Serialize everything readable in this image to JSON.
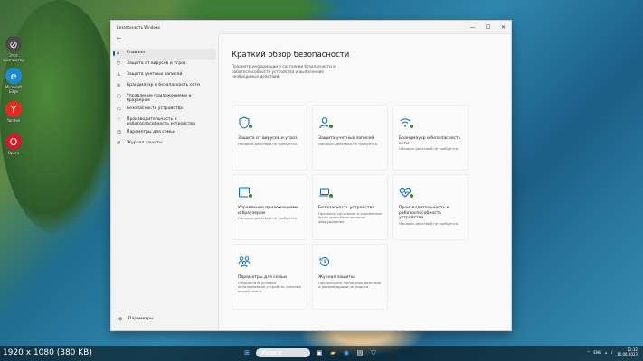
{
  "window": {
    "title": "Безопасность Windows",
    "minimize": "—",
    "maximize": "☐",
    "close": "✕",
    "back": "←"
  },
  "desktop": {
    "icons": [
      {
        "label": "Этот компьютер",
        "icon": "pc-icon",
        "color": "#4a4a4a",
        "glyph": "⊘"
      },
      {
        "label": "Microsoft Edge",
        "icon": "edge-icon",
        "color": "#1f8ad4",
        "glyph": "e"
      },
      {
        "label": "Yandex",
        "icon": "yandex-icon",
        "color": "#e8291c",
        "glyph": "Y"
      },
      {
        "label": "Opera",
        "icon": "opera-icon",
        "color": "#d21a2a",
        "glyph": "O"
      }
    ]
  },
  "sidebar": {
    "items": [
      {
        "icon": "⌂",
        "label": "Главная"
      },
      {
        "icon": "⛉",
        "label": "Защита от вирусов и угроз"
      },
      {
        "icon": "♙",
        "label": "Защита учетных записей"
      },
      {
        "icon": "⊚",
        "label": "Брандмауэр и безопасность сети"
      },
      {
        "icon": "▢",
        "label": "Управление приложениями и браузером"
      },
      {
        "icon": "▭",
        "label": "Безопасность устройства"
      },
      {
        "icon": "♡",
        "label": "Производительность и работоспособность устройства"
      },
      {
        "icon": "☺",
        "label": "Параметры для семьи"
      },
      {
        "icon": "↺",
        "label": "Журнал защиты"
      }
    ],
    "settings": {
      "icon": "⚙",
      "label": "Параметры"
    }
  },
  "main": {
    "title": "Краткий обзор безопасности",
    "description": "Просмотр информации о состоянии безопасности и работоспособности устройства и выполнение необходимых действий.",
    "tiles": [
      {
        "title": "Защита от вирусов и угроз",
        "subtitle": "Никаких действий не требуется.",
        "check": true
      },
      {
        "title": "Защита учетных записей",
        "subtitle": "Никаких действий не требуется.",
        "check": true
      },
      {
        "title": "Брандмауэр и безопасность сети",
        "subtitle": "Никаких действий не требуется.",
        "check": true
      },
      {
        "title": "Управление приложениями и браузером",
        "subtitle": "Никаких действий не требуется.",
        "check": true
      },
      {
        "title": "Безопасность устройства",
        "subtitle": "Просмотр состояния и управление функциями безопасности оборудования",
        "check": true
      },
      {
        "title": "Производительность и работоспособность устройства",
        "subtitle": "Никаких действий не требуется.",
        "check": true
      },
      {
        "title": "Параметры для семьи",
        "subtitle": "Определите условия использования устройств членами вашей семьи.",
        "check": false
      },
      {
        "title": "Журнал защиты",
        "subtitle": "Просмотрите последние действия и рекомендации по защите.",
        "check": false
      }
    ]
  },
  "statusbar": {
    "resolution": "1920 x 1080 (380 KB)"
  },
  "taskbar": {
    "search": "Поиск",
    "lang": "ENG",
    "time": "12:32",
    "date": "10.06.2023"
  },
  "colors": {
    "accent": "#0067c0",
    "ok": "#107c10"
  }
}
